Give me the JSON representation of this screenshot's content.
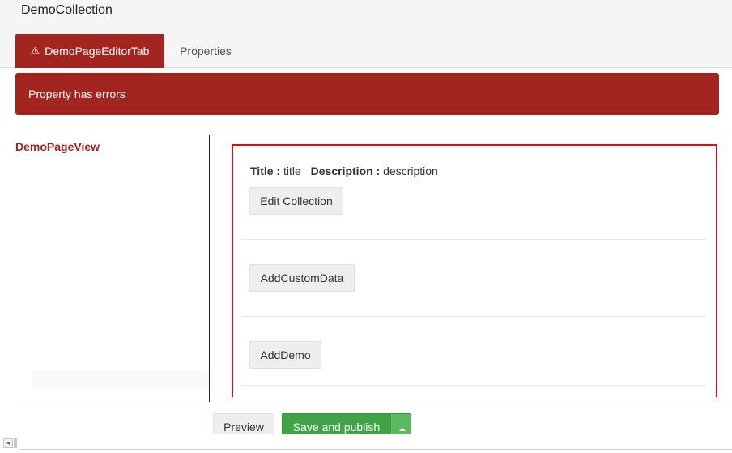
{
  "header": {
    "title": "DemoCollection",
    "tabs": [
      {
        "label": "DemoPageEditorTab",
        "icon": "warning-icon",
        "warning_glyph": "⚠",
        "active": true
      },
      {
        "label": "Properties",
        "active": false
      }
    ]
  },
  "error": {
    "message": "Property has errors"
  },
  "property": {
    "label": "DemoPageView",
    "title_label": "Title :",
    "title_value": "title",
    "description_label": "Description :",
    "description_value": "description",
    "buttons": {
      "edit_collection": "Edit Collection",
      "add_custom_data": "AddCustomData",
      "add_demo": "AddDemo"
    }
  },
  "footer": {
    "preview": "Preview",
    "save_publish": "Save and publish",
    "save_options_icon": "caret-up-icon"
  },
  "scrollbar": {
    "left_arrow": "◂"
  },
  "colors": {
    "error": "#a2261f",
    "validation_border": "#d80f16",
    "primary": "#41a347",
    "secondary_button": "#eeeeee"
  }
}
